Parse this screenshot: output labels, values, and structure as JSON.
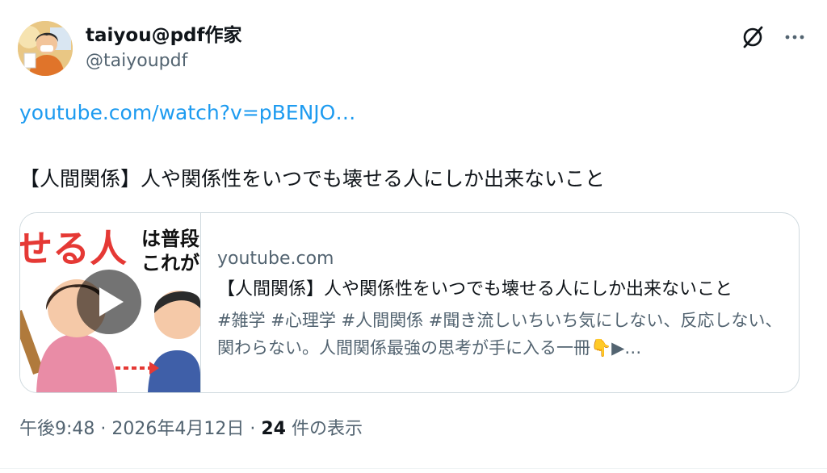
{
  "author": {
    "display_name": "taiyou@pdf作家",
    "handle": "@taiyoupdf"
  },
  "post": {
    "link_text": "youtube.com/watch?v=pBENJO…",
    "body": "【人間関係】人や関係性をいつでも壊せる人にしか出来ないこと"
  },
  "card": {
    "thumb_text_red": "せる人",
    "thumb_text_black_1": "は普段",
    "thumb_text_black_2": "これが",
    "domain": "youtube.com",
    "title": "【人間関係】人や関係性をいつでも壊せる人にしか出来ないこと",
    "description": "#雑学 #心理学 #人間関係 #聞き流しいちいち気にしない、反応しない、関わらない。人間関係最強の思考が手に入る一冊👇▶…"
  },
  "meta": {
    "time": "午後9:48",
    "sep1": " · ",
    "date": "2026年4月12日",
    "sep2": " · ",
    "views_count": "24",
    "views_label": " 件の表示"
  },
  "icons": {
    "grok": "slash-circle-icon",
    "more": "more-dots-icon"
  }
}
